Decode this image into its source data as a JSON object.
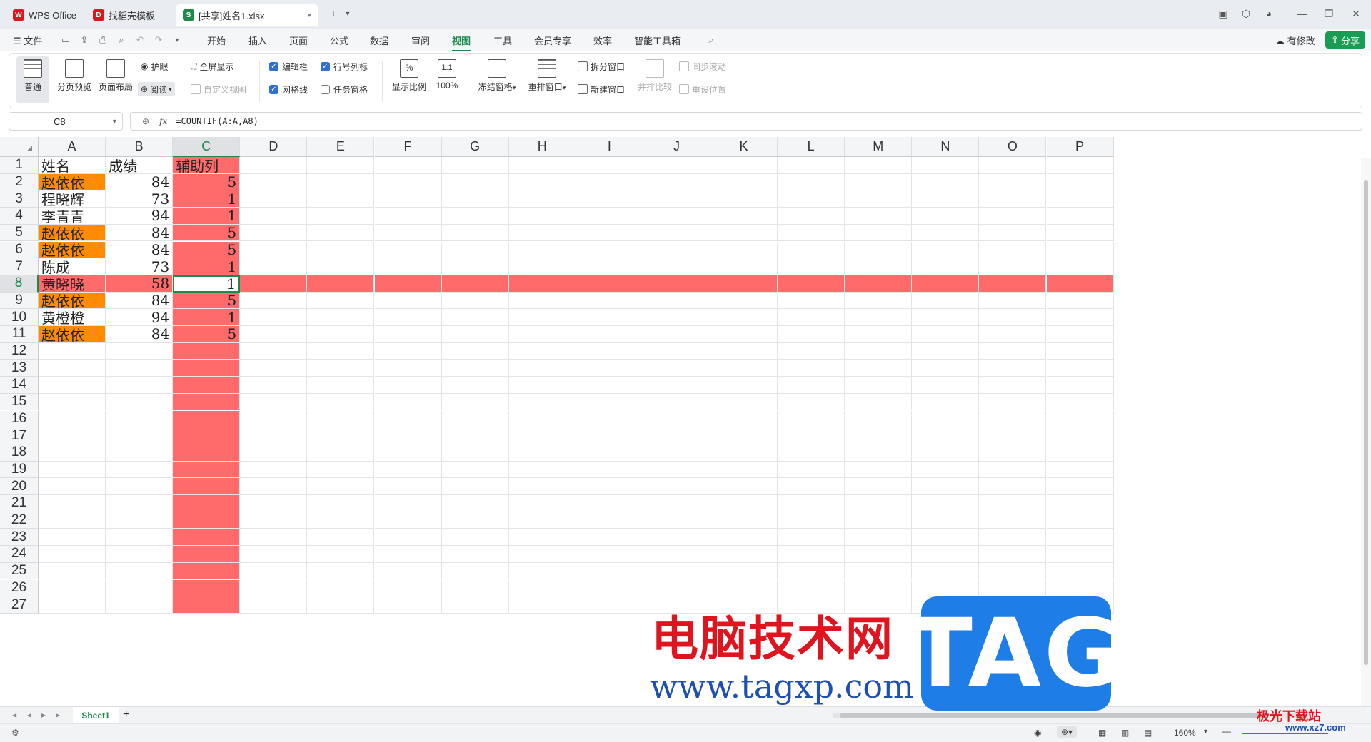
{
  "tabs": [
    {
      "label": "WPS Office",
      "color": "#e0141e",
      "glyph": "W"
    },
    {
      "label": "找稻壳模板",
      "color": "#e0141e",
      "glyph": "D"
    },
    {
      "label": "[共享]姓名1.xlsx",
      "color": "#1b8a4a",
      "glyph": "S"
    }
  ],
  "menu": {
    "file": "文件",
    "items": [
      "开始",
      "插入",
      "页面",
      "公式",
      "数据",
      "审阅",
      "视图",
      "工具",
      "会员专享",
      "效率",
      "智能工具箱"
    ],
    "active": "视图",
    "changes": "有修改",
    "share": "分享"
  },
  "ribbon": {
    "normal": "普通",
    "page_break": "分页预览",
    "page_layout": "页面布局",
    "eye_care": "护眼",
    "reading": "阅读",
    "fullscreen": "全屏显示",
    "custom_view": "自定义视图",
    "formula_bar": "编辑栏",
    "row_col_headers": "行号列标",
    "gridlines": "网格线",
    "task_pane": "任务窗格",
    "zoom": "显示比例",
    "zoom100": "100%",
    "zoom100_icon": "1:1",
    "freeze": "冻结窗格",
    "rearrange": "重排窗口",
    "split": "拆分窗口",
    "new_window": "新建窗口",
    "side_by_side": "并排比较",
    "sync_scroll": "同步滚动",
    "reset_pos": "重设位置",
    "checks": {
      "formula_bar": true,
      "row_col_headers": true,
      "gridlines": true,
      "task_pane": false
    }
  },
  "formula": {
    "name_box": "C8",
    "fx": "fx",
    "content": "=COUNTIF(A:A,A8)"
  },
  "columns": [
    "A",
    "B",
    "C",
    "D",
    "E",
    "F",
    "G",
    "H",
    "I",
    "J",
    "K",
    "L",
    "M",
    "N",
    "O",
    "P"
  ],
  "selected_column": "C",
  "selected_row": 8,
  "rows": [
    {
      "n": "1",
      "a": "姓名",
      "b": "成绩",
      "c": "辅助列"
    },
    {
      "n": "2",
      "a": "赵依依",
      "b": "84",
      "c": "5"
    },
    {
      "n": "3",
      "a": "程晓辉",
      "b": "73",
      "c": "1"
    },
    {
      "n": "4",
      "a": "李青青",
      "b": "94",
      "c": "1"
    },
    {
      "n": "5",
      "a": "赵依依",
      "b": "84",
      "c": "5"
    },
    {
      "n": "6",
      "a": "赵依依",
      "b": "84",
      "c": "5"
    },
    {
      "n": "7",
      "a": "陈成",
      "b": "73",
      "c": "1"
    },
    {
      "n": "8",
      "a": "黄晓晓",
      "b": "58",
      "c": "1"
    },
    {
      "n": "9",
      "a": "赵依依",
      "b": "84",
      "c": "5"
    },
    {
      "n": "10",
      "a": "黄橙橙",
      "b": "94",
      "c": "1"
    },
    {
      "n": "11",
      "a": "赵依依",
      "b": "84",
      "c": "5"
    },
    {
      "n": "12"
    },
    {
      "n": "13"
    },
    {
      "n": "14"
    },
    {
      "n": "15"
    },
    {
      "n": "16"
    },
    {
      "n": "17"
    },
    {
      "n": "18"
    },
    {
      "n": "19"
    },
    {
      "n": "20"
    },
    {
      "n": "21"
    },
    {
      "n": "22"
    },
    {
      "n": "23"
    },
    {
      "n": "24"
    },
    {
      "n": "25"
    },
    {
      "n": "26"
    },
    {
      "n": "27"
    }
  ],
  "highlight": {
    "orange_name": "赵依依",
    "orange": "#ff8c00",
    "red": "#ff6b6b",
    "active_border": "#1b8a4a"
  },
  "sheet_tabs": [
    "Sheet1"
  ],
  "status": {
    "zoom": "160%"
  },
  "watermark": {
    "cn": "电脑技术网",
    "url": "www.tagxp.com",
    "tag": "TAG",
    "xz": "极光下载站",
    "xz_url": "www.xz7.com"
  }
}
